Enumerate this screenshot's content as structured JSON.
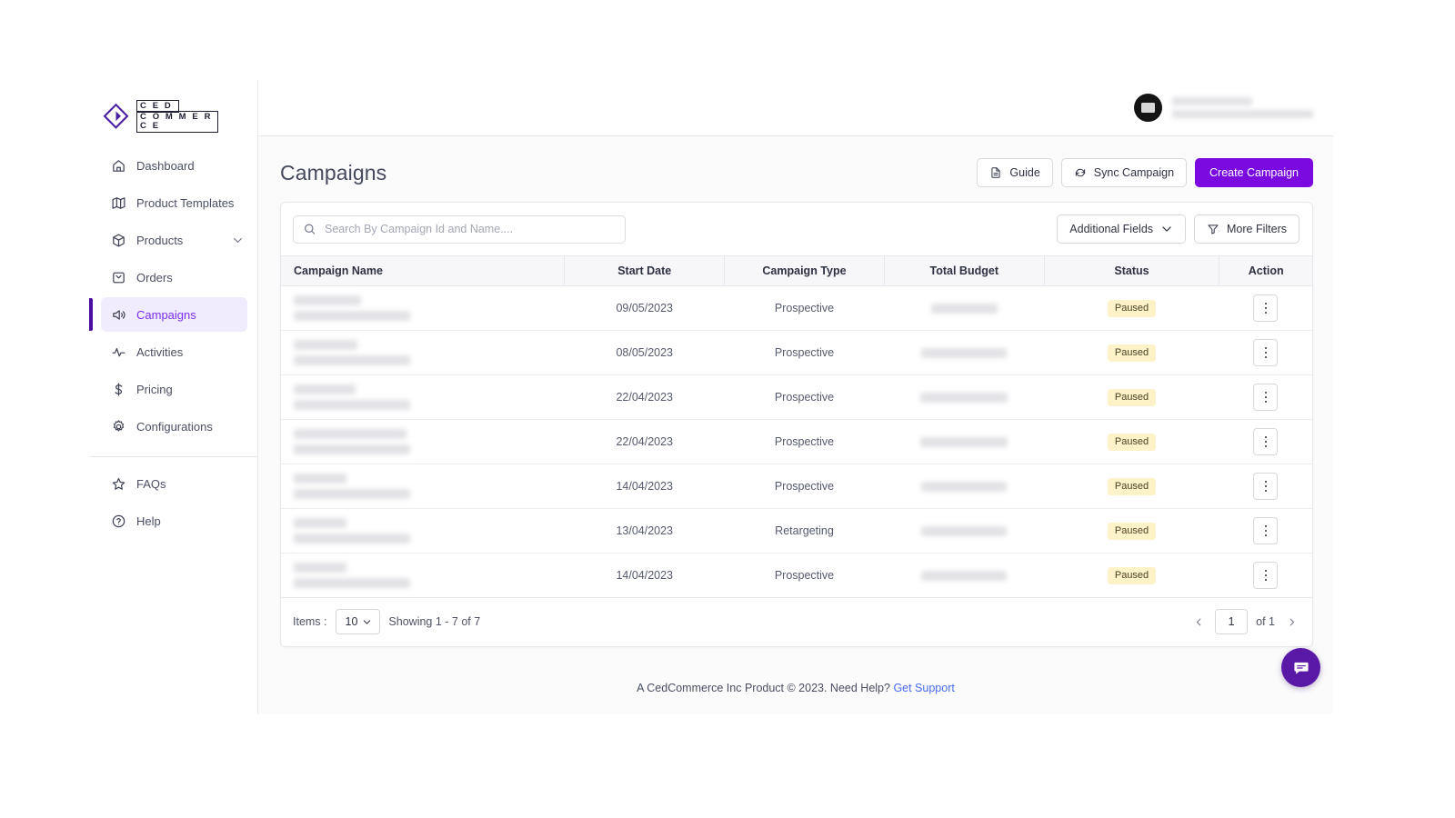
{
  "brand": {
    "logo_line1": "C E D",
    "logo_line2": "C O M M E R C E",
    "accent": "#7b0ae0",
    "active_nav_bg": "#f1ecfd",
    "active_nav_text": "#7b2ff2",
    "badge_bg": "#fdf2c8"
  },
  "sidebar": {
    "items": [
      {
        "label": "Dashboard",
        "icon": "home-icon",
        "active": false,
        "chevron": false
      },
      {
        "label": "Product Templates",
        "icon": "map-icon",
        "active": false,
        "chevron": false
      },
      {
        "label": "Products",
        "icon": "box-icon",
        "active": false,
        "chevron": true
      },
      {
        "label": "Orders",
        "icon": "inbox-icon",
        "active": false,
        "chevron": false
      },
      {
        "label": "Campaigns",
        "icon": "megaphone-icon",
        "active": true,
        "chevron": false
      },
      {
        "label": "Activities",
        "icon": "activity-icon",
        "active": false,
        "chevron": false
      },
      {
        "label": "Pricing",
        "icon": "dollar-icon",
        "active": false,
        "chevron": false
      },
      {
        "label": "Configurations",
        "icon": "gear-icon",
        "active": false,
        "chevron": false
      }
    ],
    "secondary_items": [
      {
        "label": "FAQs",
        "icon": "star-icon"
      },
      {
        "label": "Help",
        "icon": "question-circle-icon"
      }
    ]
  },
  "topbar": {
    "avatar_icon": "user-avatar",
    "user_name_redacted": true,
    "user_email_redacted": true
  },
  "page": {
    "title": "Campaigns"
  },
  "head_actions": {
    "guide_label": "Guide",
    "guide_icon": "document-icon",
    "sync_label": "Sync Campaign",
    "sync_icon": "refresh-icon",
    "create_label": "Create Campaign"
  },
  "toolbar": {
    "search_placeholder": "Search By Campaign Id and Name....",
    "search_value": "",
    "search_icon": "search-icon",
    "additional_fields_label": "Additional Fields",
    "additional_fields_icon": "chevron-down-icon",
    "more_filters_label": "More Filters",
    "more_filters_icon": "filter-icon"
  },
  "table": {
    "columns": [
      "Campaign Name",
      "Start Date",
      "Campaign Type",
      "Total Budget",
      "Status",
      "Action"
    ],
    "rows": [
      {
        "name_redacted": true,
        "name_w1": 74,
        "name_w2": 128,
        "start_date": "09/05/2023",
        "campaign_type": "Prospective",
        "budget_redacted": true,
        "budget_w": 73,
        "status": "Paused",
        "action_icon": "kebab-menu-icon"
      },
      {
        "name_redacted": true,
        "name_w1": 70,
        "name_w2": 128,
        "start_date": "08/05/2023",
        "campaign_type": "Prospective",
        "budget_redacted": true,
        "budget_w": 94,
        "status": "Paused",
        "action_icon": "kebab-menu-icon"
      },
      {
        "name_redacted": true,
        "name_w1": 68,
        "name_w2": 128,
        "start_date": "22/04/2023",
        "campaign_type": "Prospective",
        "budget_redacted": true,
        "budget_w": 96,
        "status": "Paused",
        "action_icon": "kebab-menu-icon"
      },
      {
        "name_redacted": true,
        "name_w1": 124,
        "name_w2": 128,
        "start_date": "22/04/2023",
        "campaign_type": "Prospective",
        "budget_redacted": true,
        "budget_w": 96,
        "status": "Paused",
        "action_icon": "kebab-menu-icon"
      },
      {
        "name_redacted": true,
        "name_w1": 58,
        "name_w2": 128,
        "start_date": "14/04/2023",
        "campaign_type": "Prospective",
        "budget_redacted": true,
        "budget_w": 94,
        "status": "Paused",
        "action_icon": "kebab-menu-icon"
      },
      {
        "name_redacted": true,
        "name_w1": 58,
        "name_w2": 128,
        "start_date": "13/04/2023",
        "campaign_type": "Retargeting",
        "budget_redacted": true,
        "budget_w": 94,
        "status": "Paused",
        "action_icon": "kebab-menu-icon"
      },
      {
        "name_redacted": true,
        "name_w1": 58,
        "name_w2": 128,
        "start_date": "14/04/2023",
        "campaign_type": "Prospective",
        "budget_redacted": true,
        "budget_w": 94,
        "status": "Paused",
        "action_icon": "kebab-menu-icon"
      }
    ]
  },
  "pagination": {
    "items_label": "Items :",
    "page_size": "10",
    "showing_text": "Showing 1 - 7 of 7",
    "prev_icon": "chevron-left-icon",
    "next_icon": "chevron-right-icon",
    "current_page": "1",
    "of_text": "of  1"
  },
  "footer": {
    "text": "A CedCommerce Inc Product © 2023. Need Help? ",
    "link_label": "Get Support",
    "chat_icon": "chat-bubble-icon"
  }
}
